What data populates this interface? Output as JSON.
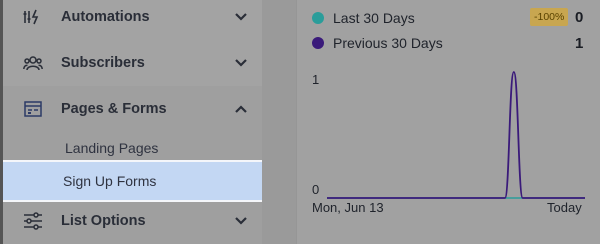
{
  "sidebar": {
    "items": [
      {
        "label": "Automations",
        "icon": "automations-icon",
        "expanded": false
      },
      {
        "label": "Subscribers",
        "icon": "subscribers-icon",
        "expanded": false
      },
      {
        "label": "Pages & Forms",
        "icon": "pages-forms-icon",
        "expanded": true,
        "children": [
          {
            "label": "Landing Pages",
            "selected": false
          },
          {
            "label": "Sign Up Forms",
            "selected": true
          }
        ]
      },
      {
        "label": "List Options",
        "icon": "list-options-icon",
        "expanded": false
      }
    ]
  },
  "stats": {
    "current": {
      "label": "Last 30 Days",
      "value": "0",
      "change": "-100%",
      "color": "#2a9d9a"
    },
    "previous": {
      "label": "Previous 30 Days",
      "value": "1",
      "color": "#3a1a7a"
    }
  },
  "chart_data": {
    "type": "line",
    "x_labels": [
      "Mon, Jun 13",
      "Today"
    ],
    "y_ticks": [
      "0",
      "1"
    ],
    "ylim": [
      0,
      1
    ],
    "series": [
      {
        "name": "Last 30 Days",
        "color": "#2a9d9a",
        "values": [
          0,
          0,
          0,
          0,
          0,
          0,
          0,
          0,
          0,
          0,
          0,
          0,
          0,
          0,
          0,
          0,
          0,
          0,
          0,
          0,
          0,
          0,
          0,
          0,
          0,
          0,
          0,
          0,
          0,
          0
        ]
      },
      {
        "name": "Previous 30 Days",
        "color": "#3a1a7a",
        "values": [
          0,
          0,
          0,
          0,
          0,
          0,
          0,
          0,
          0,
          0,
          0,
          0,
          0,
          0,
          0,
          0,
          0,
          0,
          0,
          0,
          0,
          1,
          0,
          0,
          0,
          0,
          0,
          0,
          0,
          0
        ]
      }
    ]
  }
}
